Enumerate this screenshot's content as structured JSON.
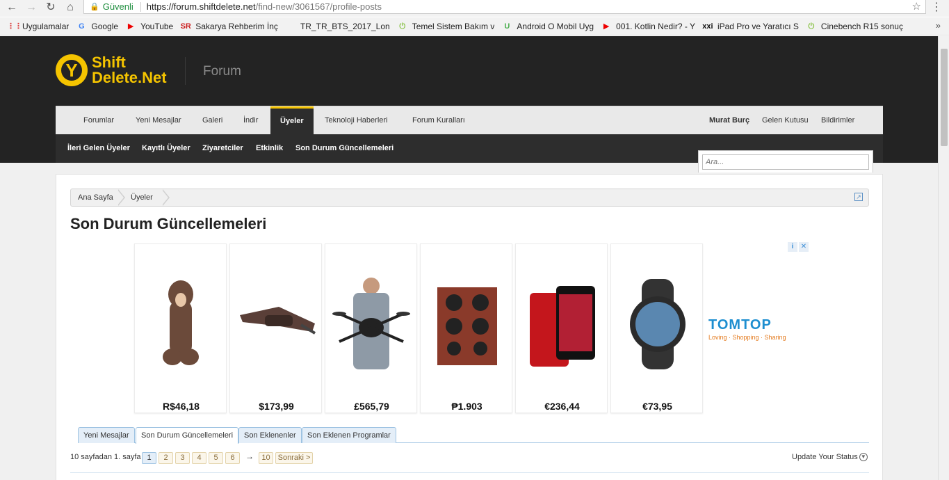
{
  "browser": {
    "secure_label": "Güvenli",
    "url_host": "https://forum.shiftdelete.net",
    "url_path": "/find-new/3061567/profile-posts",
    "bookmarks": [
      {
        "icon": "apps-icon",
        "label": "Uygulamalar"
      },
      {
        "icon": "google-icon",
        "label": "Google"
      },
      {
        "icon": "youtube-icon",
        "label": "YouTube"
      },
      {
        "icon": "sr-icon",
        "label": "Sakarya Rehberim İnç"
      },
      {
        "icon": "apple-icon",
        "label": "TR_TR_BTS_2017_Lon"
      },
      {
        "icon": "power-icon",
        "label": "Temel Sistem Bakım v"
      },
      {
        "icon": "u-icon",
        "label": "Android O Mobil Uyg"
      },
      {
        "icon": "youtube-icon",
        "label": "001. Kotlin Nedir? - Y"
      },
      {
        "icon": "xxi-icon",
        "label": "iPad Pro ve Yaratıcı S"
      },
      {
        "icon": "power-icon",
        "label": "Cinebench R15 sonuç"
      }
    ]
  },
  "site": {
    "logo_line1": "Shift",
    "logo_line2": "Delete.Net",
    "section_title": "Forum",
    "main_nav": [
      "Forumlar",
      "Yeni Mesajlar",
      "Galeri",
      "İndir",
      "Üyeler",
      "Teknoloji Haberleri",
      "Forum Kuralları"
    ],
    "user_nav": [
      "Murat Burç",
      "Gelen Kutusu",
      "Bildirimler"
    ],
    "sub_nav": [
      "İleri Gelen Üyeler",
      "Kayıtlı Üyeler",
      "Ziyaretciler",
      "Etkinlik",
      "Son Durum Güncellemeleri"
    ],
    "search_placeholder": "Ara..."
  },
  "breadcrumb": [
    "Ana Sayfa",
    "Üyeler"
  ],
  "page_title": "Son Durum Güncellemeleri",
  "ad": {
    "products": [
      {
        "price": "R$46,18"
      },
      {
        "price": "$173,99"
      },
      {
        "price": "£565,79"
      },
      {
        "price": "₱1.903"
      },
      {
        "price": "€236,44"
      },
      {
        "price": "€73,95"
      }
    ],
    "brand": "TOMTOP",
    "brand_tagline": "Loving · Shopping · Sharing"
  },
  "tabs": [
    "Yeni Mesajlar",
    "Son Durum Güncellemeleri",
    "Son Eklenenler",
    "Son Eklenen Programlar"
  ],
  "pager": {
    "info": "10 sayfadan 1. sayfa",
    "pages": [
      "1",
      "2",
      "3",
      "4",
      "5",
      "6"
    ],
    "arrow": "→",
    "last": "10",
    "next": "Sonraki >"
  },
  "update_status": "Update Your Status",
  "colors": {
    "accent": "#f5c400",
    "header_bg": "#232323",
    "tab_border": "#9ec3e2"
  }
}
